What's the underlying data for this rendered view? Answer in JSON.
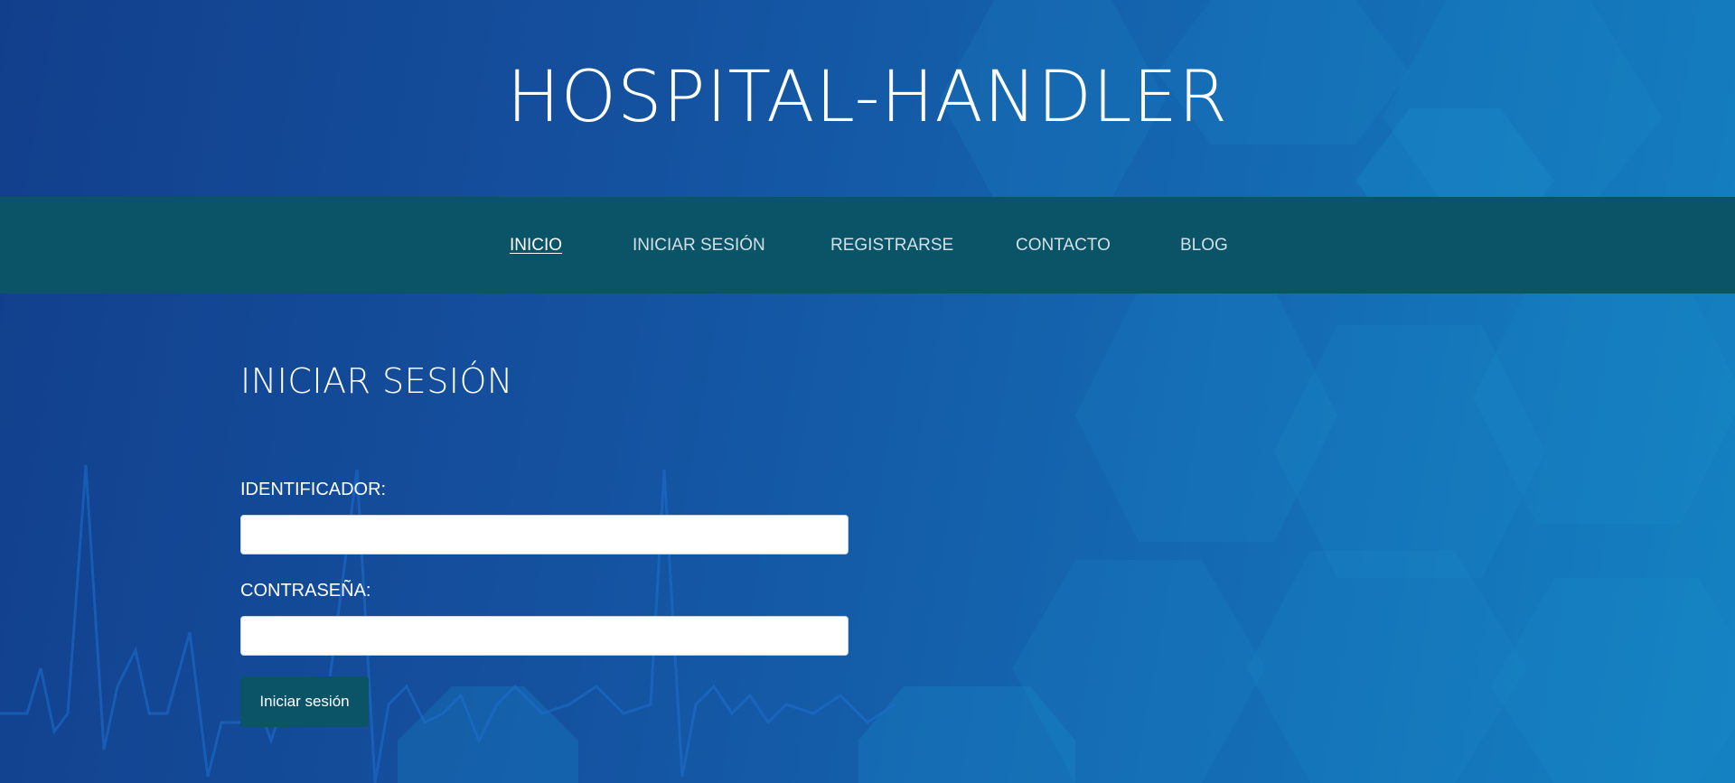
{
  "header": {
    "title": "HOSPITAL-HANDLER"
  },
  "nav": {
    "items": [
      {
        "label": "INICIO",
        "active": true
      },
      {
        "label": "INICIAR SESIÓN",
        "active": false
      },
      {
        "label": "REGISTRARSE",
        "active": false
      },
      {
        "label": "CONTACTO",
        "active": false
      },
      {
        "label": "BLOG",
        "active": false
      }
    ]
  },
  "login": {
    "title": "INICIAR SESIÓN",
    "id_label": "IDENTIFICADOR:",
    "id_value": "",
    "password_label": "CONTRASEÑA:",
    "password_value": "",
    "submit_label": "Iniciar sesión"
  },
  "colors": {
    "navbar": "#0b5468",
    "button": "#0b5468",
    "background_start": "#123f8c",
    "background_end": "#1482c2"
  }
}
